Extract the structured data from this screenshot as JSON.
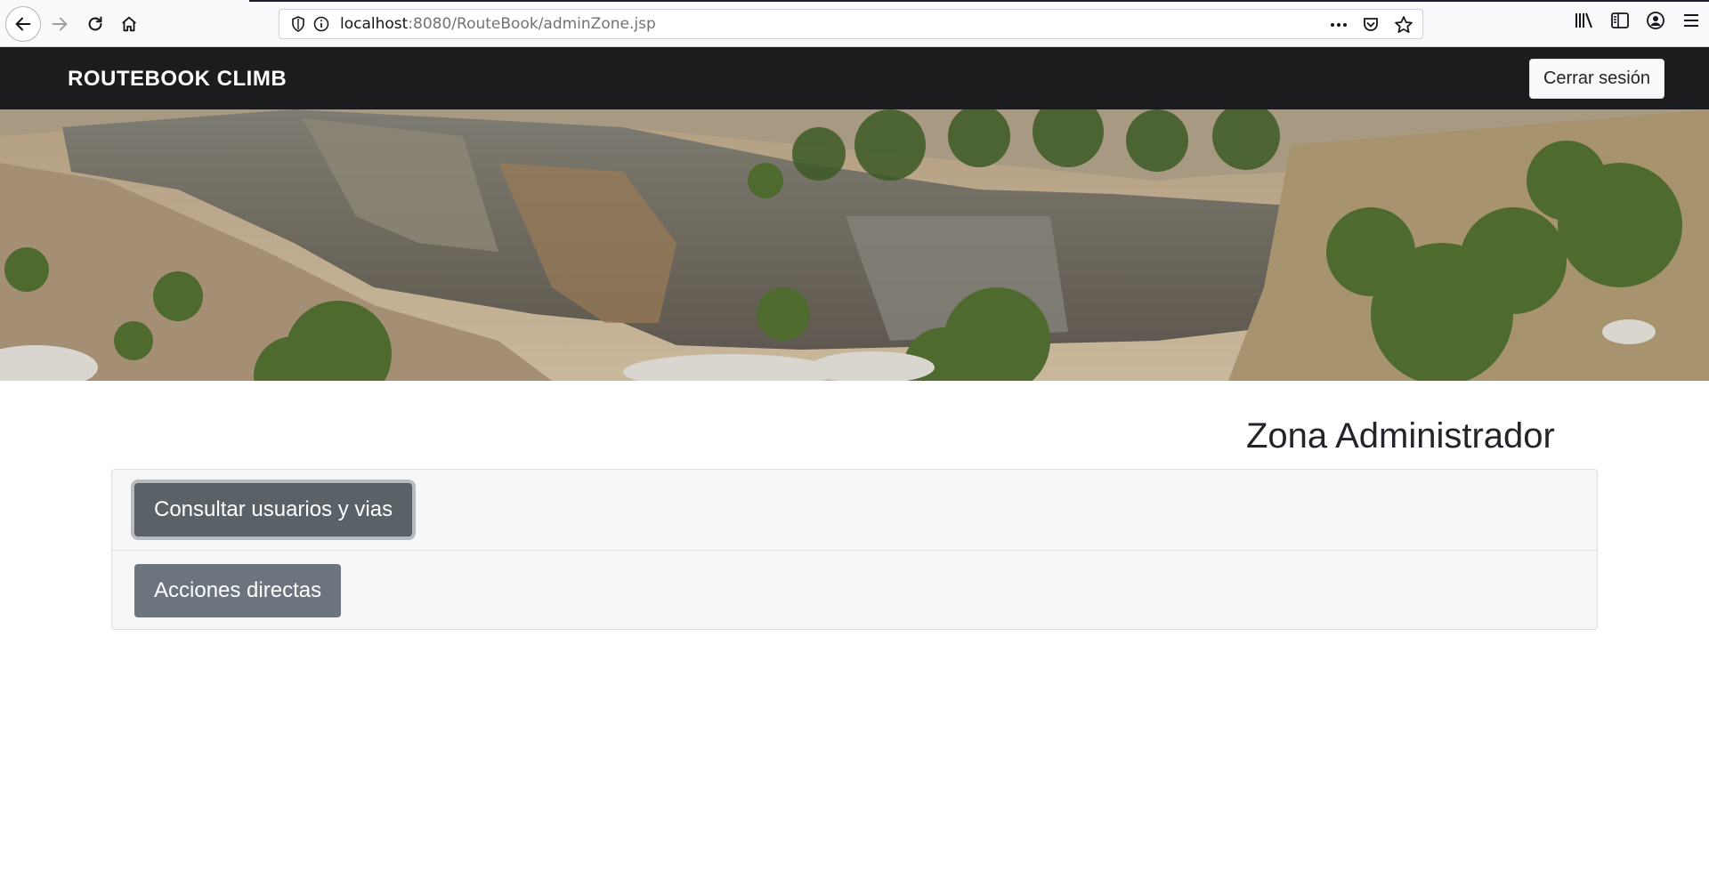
{
  "browser": {
    "url_host": "localhost",
    "url_path": ":8080/RouteBook/adminZone.jsp"
  },
  "navbar": {
    "brand_light": "ROUTEBOOK",
    "brand_bold": "CLIMB",
    "logout_label": "Cerrar sesión"
  },
  "main": {
    "title": "Zona Administrador",
    "actions": [
      {
        "label": "Consultar usuarios y vias"
      },
      {
        "label": "Acciones directas"
      }
    ]
  },
  "colors": {
    "navbar_bg": "#1c1c1e",
    "button_secondary": "#6c757d",
    "card_bg": "#f7f7f7"
  }
}
